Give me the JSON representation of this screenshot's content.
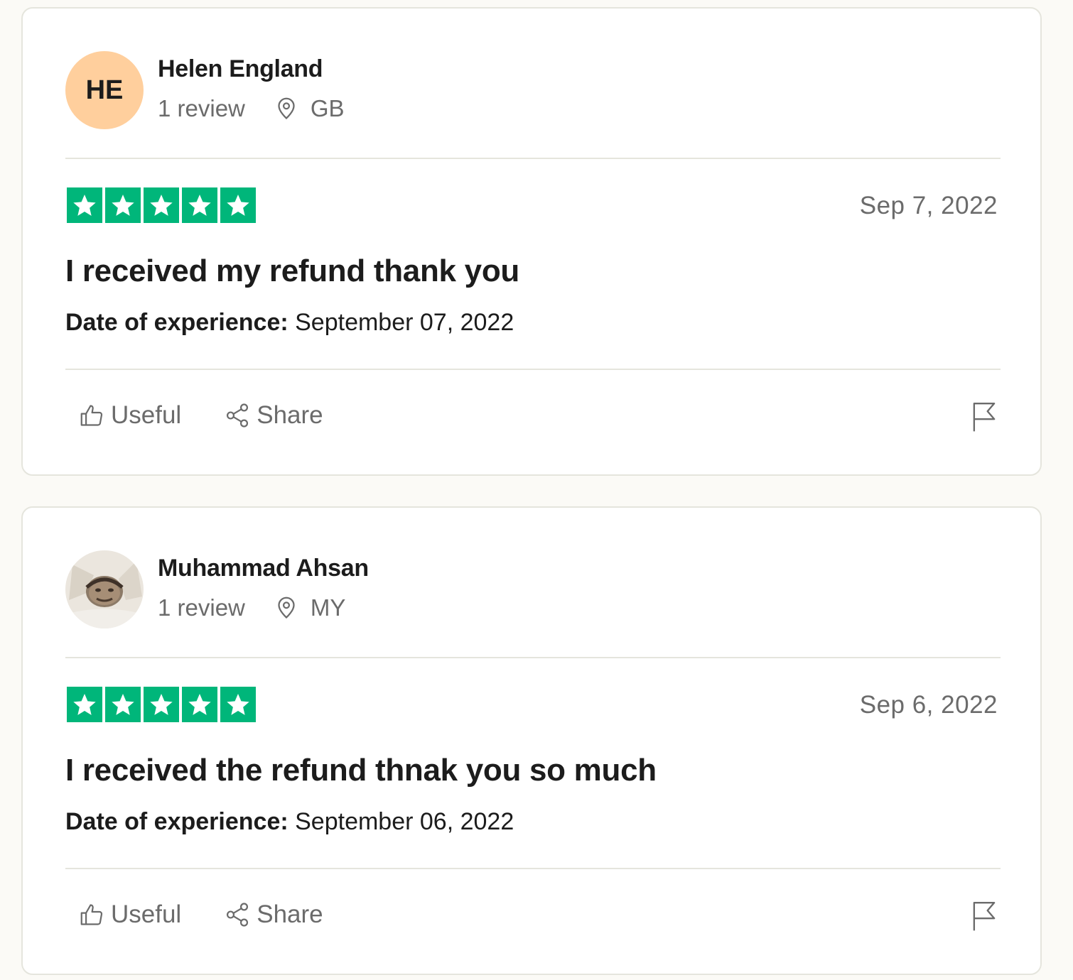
{
  "reviews": [
    {
      "avatar_initials": "HE",
      "avatar_color": "#ffcf9d",
      "name": "Helen England",
      "review_count": "1 review",
      "country": "GB",
      "rating": 5,
      "date": "Sep 7, 2022",
      "title": "I received my refund thank you",
      "experience_label": "Date of experience:",
      "experience_date": "September 07, 2022",
      "useful_label": "Useful",
      "share_label": "Share"
    },
    {
      "avatar_initials": "",
      "avatar_type": "photo",
      "name": "Muhammad Ahsan",
      "review_count": "1 review",
      "country": "MY",
      "rating": 5,
      "date": "Sep 6, 2022",
      "title": "I received the refund thnak you so much",
      "experience_label": "Date of experience:",
      "experience_date": "September 06, 2022",
      "useful_label": "Useful",
      "share_label": "Share"
    }
  ],
  "colors": {
    "star_green": "#00b67a",
    "muted_text": "#6b6b6b",
    "divider": "#e5e5dd"
  }
}
